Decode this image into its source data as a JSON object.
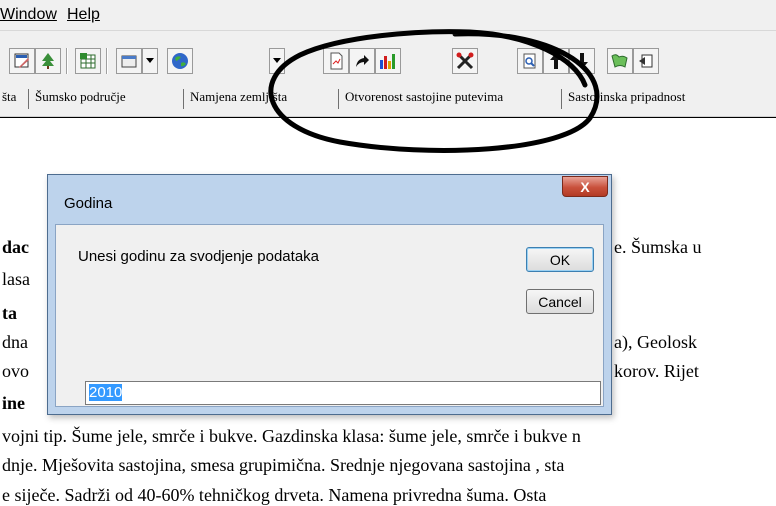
{
  "menu": {
    "items": [
      "Window",
      "Help"
    ]
  },
  "tabs": [
    "šta",
    "Šumsko područje",
    "Namjena zemljišta",
    "Otvorenost sastojine putevima",
    "Sastojinska pripadnost"
  ],
  "toolbar": {
    "icons": [
      "document-edit-icon",
      "tree-icon",
      "spreadsheet-icon",
      "window-icon",
      "globe-icon",
      "report-icon",
      "redo-arrow-icon",
      "bar-chart-icon",
      "tools-icon",
      "search-doc-icon",
      "arrow-up-icon",
      "arrow-down-icon",
      "map-icon",
      "exit-icon"
    ]
  },
  "document": {
    "lines": [
      {
        "left": "dac",
        "right": "e. Šumska u",
        "bold_left": true
      },
      {
        "left": "lasa",
        "right": ""
      },
      {
        "left": "ta",
        "right": "",
        "bold_left": true
      },
      {
        "left": "dna",
        "right": "a),  Geolosk"
      },
      {
        "left": "ovo",
        "right": "korov. Rijet"
      },
      {
        "left": "ine",
        "right": "",
        "bold_left": true
      },
      {
        "left": "vojni tip. Šume jele, smrče i bukve. Gazdinska klasa: šume jele, smrče i bukve n",
        "right": ""
      },
      {
        "left": "dnje. Mješovita sastojina, smesa grupimična. Srednje njegovana sastojina , sta",
        "right": ""
      },
      {
        "left": "e siječe. Sadrži od 40-60% tehničkog drveta. Namena privredna šuma.  Osta",
        "right": ""
      }
    ]
  },
  "dialog": {
    "title": "Godina",
    "message": "Unesi godinu za svodjenje podataka",
    "ok_label": "OK",
    "cancel_label": "Cancel",
    "input_value": "2010",
    "close_symbol": "X"
  },
  "colors": {
    "annotation": "#000000",
    "dialog_frame": "#bdd3ec",
    "selection": "#3399ff",
    "close_button": "#c9513c"
  }
}
